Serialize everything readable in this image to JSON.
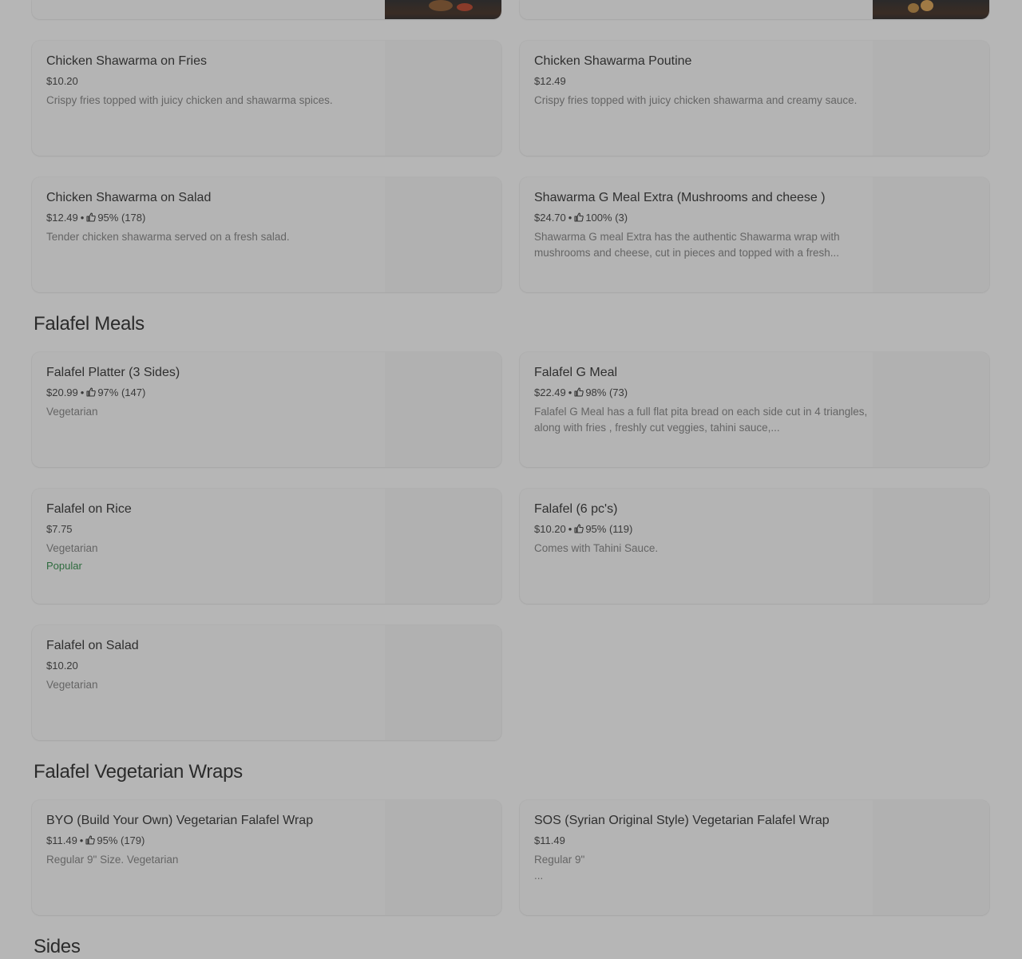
{
  "sections": [
    {
      "title": "Falafel Meals"
    },
    {
      "title": "Falafel Vegetarian Wraps"
    },
    {
      "title": "Sides"
    }
  ],
  "items": [
    {
      "name": "Chicken Shawarma on Fries",
      "price": "$10.20",
      "rating": "",
      "description": "Crispy fries topped with juicy chicken and shawarma spices.",
      "badge": ""
    },
    {
      "name": "Chicken Shawarma Poutine",
      "price": "$12.49",
      "rating": "",
      "description": "Crispy fries topped with juicy chicken shawarma and creamy sauce.",
      "badge": ""
    },
    {
      "name": "Chicken Shawarma on Salad",
      "price": "$12.49",
      "rating": "95% (178)",
      "description": "Tender chicken shawarma served on a fresh salad.",
      "badge": ""
    },
    {
      "name": "Shawarma G Meal Extra (Mushrooms and cheese )",
      "price": "$24.70",
      "rating": "100% (3)",
      "description": "Shawarma G meal Extra has the authentic Shawarma wrap with mushrooms and cheese, cut in pieces and topped with a fresh...",
      "badge": ""
    },
    {
      "name": "Falafel Platter (3 Sides)",
      "price": "$20.99",
      "rating": "97% (147)",
      "description": "Vegetarian",
      "badge": ""
    },
    {
      "name": "Falafel G Meal",
      "price": "$22.49",
      "rating": "98% (73)",
      "description": "Falafel G Meal has a full flat pita bread on each side cut in 4 triangles, along with fries , freshly cut veggies, tahini sauce,...",
      "badge": ""
    },
    {
      "name": "Falafel on Rice",
      "price": "$7.75",
      "rating": "",
      "description": "Vegetarian",
      "badge": "Popular"
    },
    {
      "name": "Falafel (6 pc's)",
      "price": "$10.20",
      "rating": "95% (119)",
      "description": "Comes with Tahini Sauce.",
      "badge": ""
    },
    {
      "name": "Falafel on Salad",
      "price": "$10.20",
      "rating": "",
      "description": "Vegetarian",
      "badge": ""
    },
    {
      "name": "BYO (Build Your Own) Vegetarian Falafel Wrap",
      "price": "$11.49",
      "rating": "95% (179)",
      "description": "Regular 9\" Size. Vegetarian",
      "badge": ""
    },
    {
      "name": "SOS (Syrian Original Style) Vegetarian Falafel Wrap",
      "price": "$11.49",
      "rating": "",
      "description": "Regular 9\"\n...",
      "badge": ""
    }
  ],
  "colors": {
    "overlay_background": "#b6b6b6",
    "popular_badge": "#2e6b3e"
  },
  "icons": {
    "rating": "thumbs-up-icon"
  }
}
